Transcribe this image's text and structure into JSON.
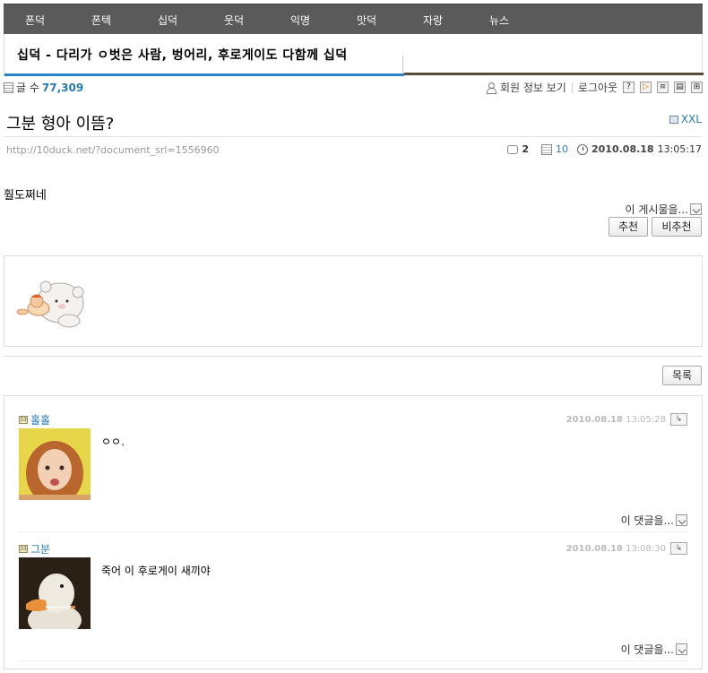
{
  "topnav": {
    "items": [
      "폰덕",
      "폰텍",
      "십덕",
      "웃덕",
      "익명",
      "맛덕",
      "자랑",
      "뉴스"
    ]
  },
  "board": {
    "title": "십덕 - 다리가 ㅇ벗은 사람, 벙어리, 후로게이도 다함께 십덕"
  },
  "infobar": {
    "post_count_label": "글 수",
    "post_count": "77,309",
    "member_info": "회원 정보 보기",
    "logout": "로그아웃",
    "help_btn": "?"
  },
  "post": {
    "title": "그분 형아 이뜸?",
    "size_label": "XXL",
    "url": "http://10duck.net/?document_srl=1556960",
    "comment_count": "2",
    "read_count": "10",
    "date": "2010.08.18",
    "time": "13:05:17",
    "body": "훨도쩌네",
    "share": "이 게시물을...",
    "recommend": "추천",
    "not_recommend": "비추천",
    "list_button": "목록"
  },
  "comments": [
    {
      "author": "홀홀",
      "date": "2010.08.18",
      "time": "13:05:28",
      "text": "ㅇㅇ.",
      "share": "이 댓글을..."
    },
    {
      "author": "그분",
      "date": "2010.08.18",
      "time": "13:08:30",
      "text": "죽어 이 후로게이 새끼야",
      "share": "이 댓글을..."
    }
  ],
  "colors": {
    "nav_bg": "#5a5a5a",
    "accent_blue": "#2a83c9",
    "link": "#2a7ab0"
  }
}
